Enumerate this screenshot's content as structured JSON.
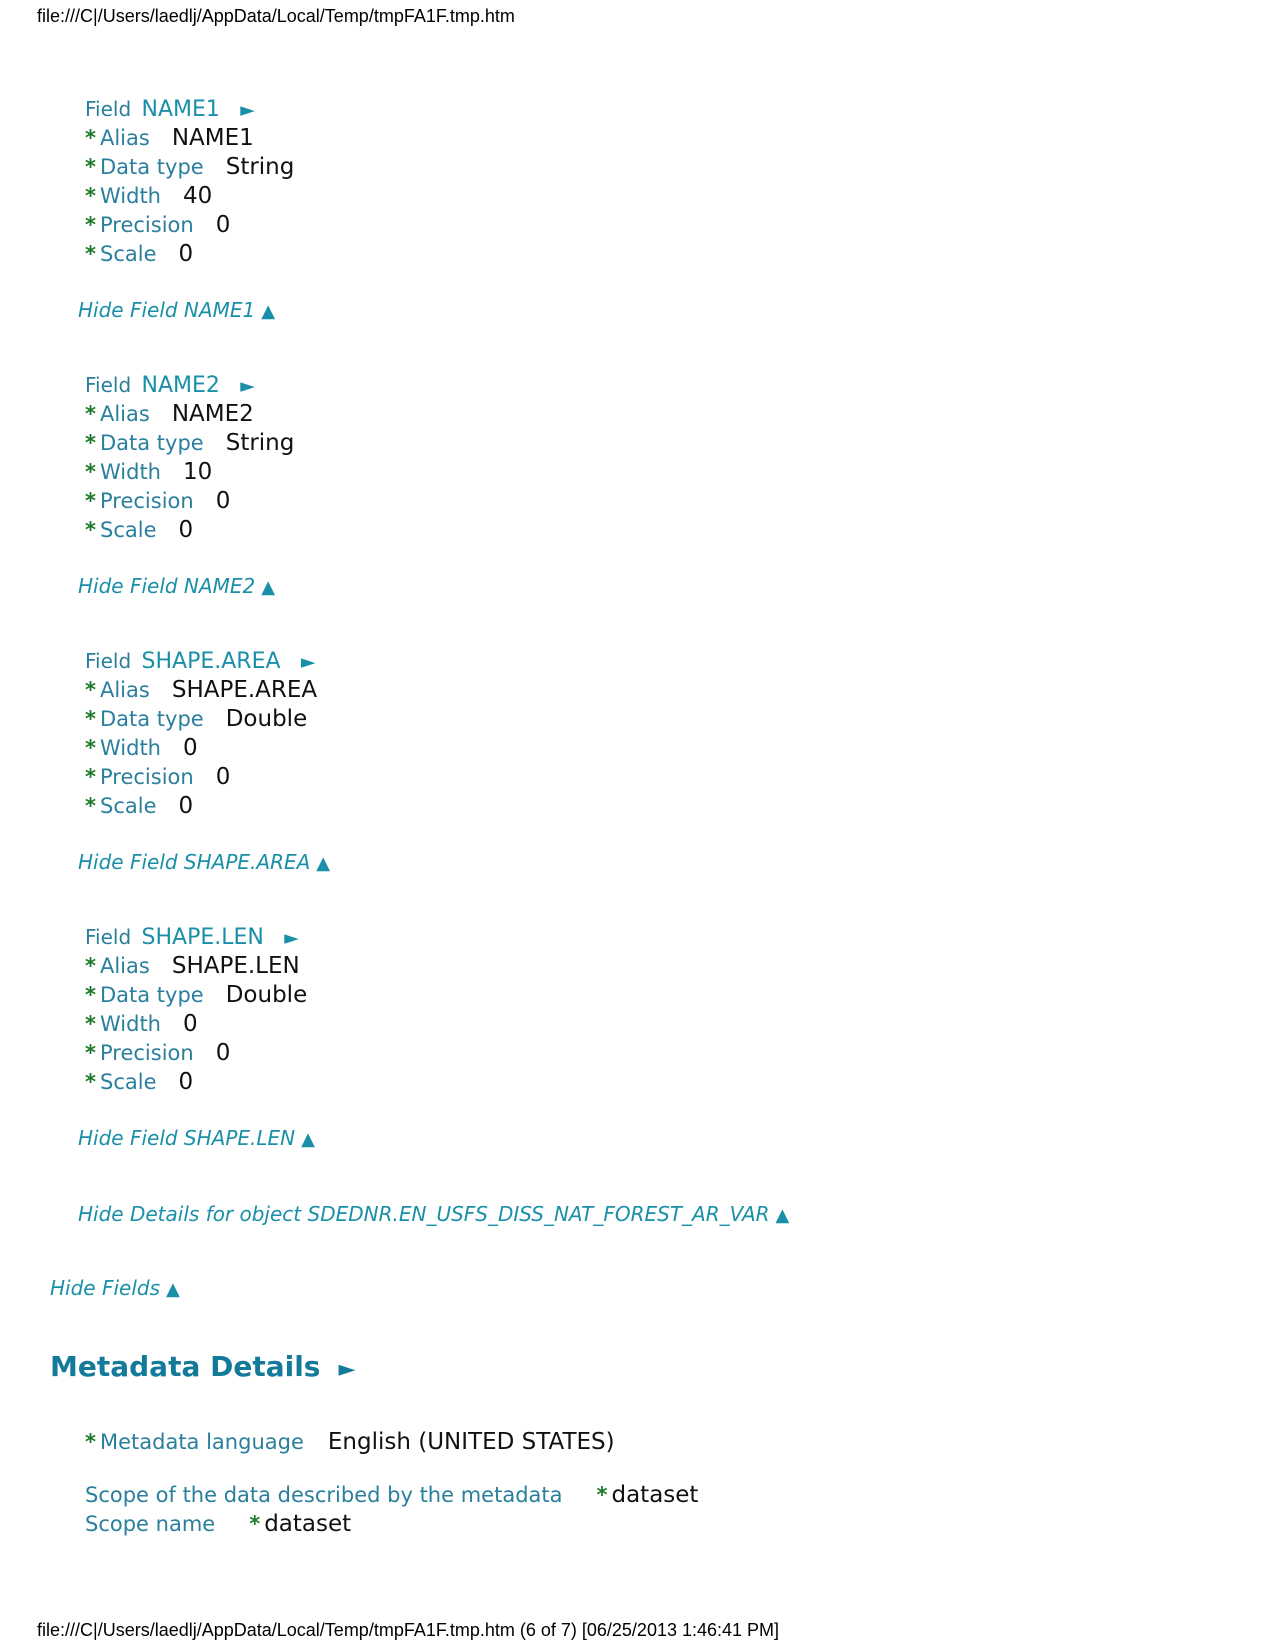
{
  "browser": {
    "header_path": "file:///C|/Users/laedlj/AppData/Local/Temp/tmpFA1F.tmp.htm",
    "footer_text": "file:///C|/Users/laedlj/AppData/Local/Temp/tmpFA1F.tmp.htm (6 of 7) [06/25/2013 1:46:41 PM]"
  },
  "labels": {
    "field": "Field",
    "alias": "Alias",
    "data_type": "Data type",
    "width": "Width",
    "precision": "Precision",
    "scale": "Scale",
    "star": "*",
    "expand_arrow": "►",
    "collapse_arrow": "▲"
  },
  "fields": [
    {
      "name": "NAME1",
      "alias": "NAME1",
      "data_type": "String",
      "width": "40",
      "precision": "0",
      "scale": "0",
      "hide_label": "Hide Field NAME1"
    },
    {
      "name": "NAME2",
      "alias": "NAME2",
      "data_type": "String",
      "width": "10",
      "precision": "0",
      "scale": "0",
      "hide_label": "Hide Field NAME2"
    },
    {
      "name": "SHAPE.AREA",
      "alias": "SHAPE.AREA",
      "data_type": "Double",
      "width": "0",
      "precision": "0",
      "scale": "0",
      "hide_label": "Hide Field SHAPE.AREA"
    },
    {
      "name": "SHAPE.LEN",
      "alias": "SHAPE.LEN",
      "data_type": "Double",
      "width": "0",
      "precision": "0",
      "scale": "0",
      "hide_label": "Hide Field SHAPE.LEN"
    }
  ],
  "hide_details": "Hide Details for object SDEDNR.EN_USFS_DISS_NAT_FOREST_AR_VAR",
  "hide_fields": "Hide Fields",
  "metadata_details": {
    "heading": "Metadata Details",
    "language_label": "Metadata language",
    "language_value": "English (UNITED STATES)",
    "scope_label": "Scope of the data described by the metadata",
    "scope_value": "dataset",
    "scope_name_label": "Scope name",
    "scope_name_value": "dataset"
  }
}
